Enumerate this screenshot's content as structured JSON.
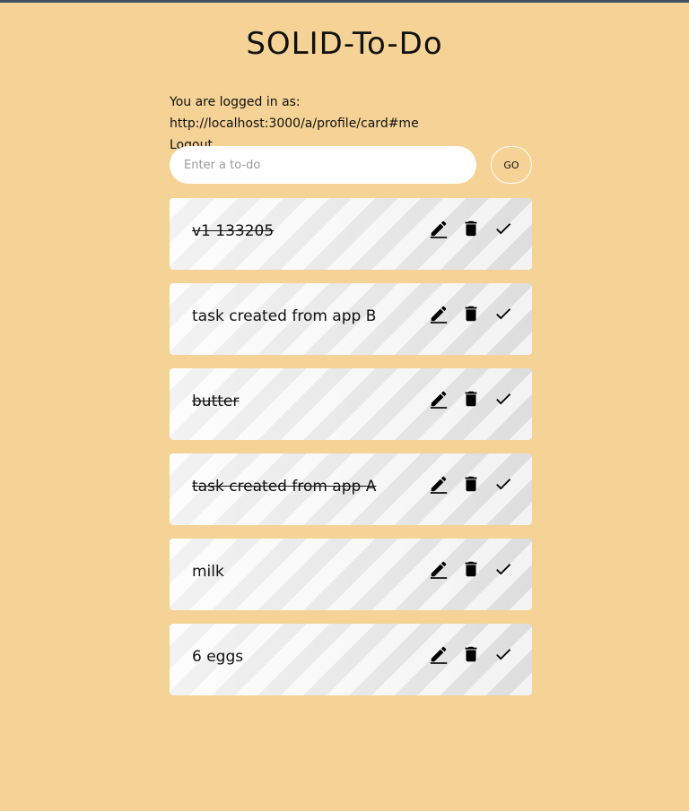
{
  "app": {
    "title": "SOLID-To-Do"
  },
  "session": {
    "logged_in_text": "You are logged in as: http://localhost:3000/a/profile/card#me",
    "logout_label": "Logout"
  },
  "form": {
    "placeholder": "Enter a to-do",
    "go_label": "GO"
  },
  "todos": [
    {
      "text": "v1 133205",
      "completed": true
    },
    {
      "text": "task created from app B",
      "completed": false
    },
    {
      "text": "butter",
      "completed": true
    },
    {
      "text": "task created from app A",
      "completed": true
    },
    {
      "text": "milk",
      "completed": false
    },
    {
      "text": "6 eggs",
      "completed": false
    }
  ],
  "icons": {
    "edit": "pencil-icon",
    "delete": "trash-icon",
    "complete": "check-icon"
  },
  "colors": {
    "background": "#f5d295",
    "card": "#f0f0f0",
    "text": "#111111"
  }
}
